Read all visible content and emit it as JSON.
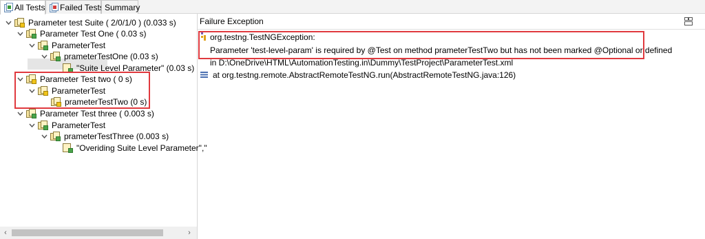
{
  "tabs": [
    {
      "label": "All Tests",
      "active": true
    },
    {
      "label": "Failed Tests",
      "active": false
    },
    {
      "label": "Summary",
      "active": false
    }
  ],
  "tree": {
    "suite": "Parameter test Suite ( 2/0/1/0 ) (0.033 s)",
    "test_one": "Parameter Test One ( 0.03 s)",
    "class_one": "ParameterTest",
    "method_one": "prameterTestOne  (0.03 s)",
    "param_one": "\"Suite Level Parameter\"  (0.03 s)",
    "test_two": "Parameter Test two ( 0 s)",
    "class_two": "ParameterTest",
    "method_two": "prameterTestTwo  (0 s)",
    "test_three": "Parameter Test three ( 0.003 s)",
    "class_three": "ParameterTest",
    "method_three": "prameterTestThree  (0.003 s)",
    "param_three": "\"Overiding Suite Level Parameter\",\""
  },
  "failure": {
    "title": "Failure Exception",
    "exception": "org.testng.TestNGException:",
    "message": "Parameter 'test-level-param' is required by @Test on method prameterTestTwo but has not been marked @Optional or defined",
    "location": "in D:\\OneDrive\\HTML\\AutomationTesting.in\\Dummy\\TestProject\\ParameterTest.xml",
    "stack": "at org.testng.remote.AbstractRemoteTestNG.run(AbstractRemoteTestNG.java:126)"
  },
  "colors": {
    "highlight_box": "#e0393e",
    "pass": "#4aa34a",
    "skip": "#f0c419"
  },
  "icons": [
    "all-tests-icon",
    "failed-tests-icon",
    "layout-icon",
    "exception-icon",
    "stack-trace-icon"
  ]
}
